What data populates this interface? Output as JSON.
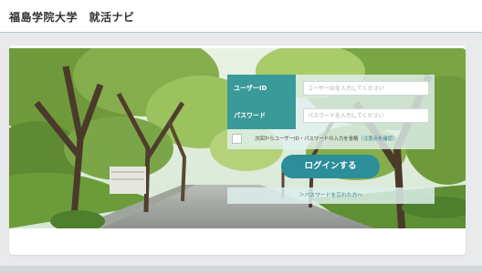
{
  "header": {
    "title": "福島学院大学　就活ナビ"
  },
  "hero": {
    "image": "tree-lined-avenue-photo"
  },
  "login": {
    "userid_label": "ユーザーID",
    "userid_placeholder": "ユーザーIDを入力してください",
    "password_label": "パスワード",
    "password_placeholder": "パスワードを入力してください",
    "remember_text": "次回からユーザーID・パスワードの入力を省略",
    "remember_link": "（注意点を確認）",
    "remember_checked": false,
    "login_button": "ログインする",
    "forgot_link": "＞パスワードを忘れた方へ"
  },
  "colors": {
    "accent": "#3a9a99",
    "button": "#2b8e98",
    "link": "#2a7fa3"
  }
}
